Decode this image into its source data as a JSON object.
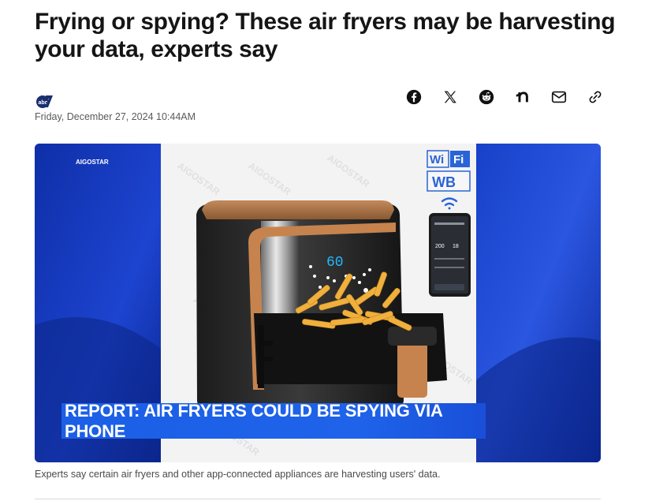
{
  "article": {
    "headline": "Frying or spying? These air fryers may be harvesting your data, experts say",
    "dateline": "Friday, December 27, 2024 10:44AM",
    "caption": "Experts say certain air fryers and other app-connected appliances are harvesting users' data."
  },
  "share": {
    "items": [
      {
        "name": "facebook-icon"
      },
      {
        "name": "x-icon"
      },
      {
        "name": "reddit-icon"
      },
      {
        "name": "nextdoor-icon"
      },
      {
        "name": "email-icon"
      },
      {
        "name": "copy-link-icon"
      }
    ]
  },
  "hero": {
    "brand_mark": "AIGOSTAR",
    "display_reading": "60",
    "wifi_label_1": "Wi",
    "wifi_label_2": "Fi",
    "badge_label": "WB",
    "phone_reading_1": "200",
    "phone_reading_2": "18",
    "lower_third": "REPORT: AIR FRYERS COULD BE SPYING VIA PHONE"
  },
  "colors": {
    "brand_blue": "#1b5fe6",
    "background_blue": "#1a3cc4",
    "fryer_accent": "#c7834d"
  }
}
